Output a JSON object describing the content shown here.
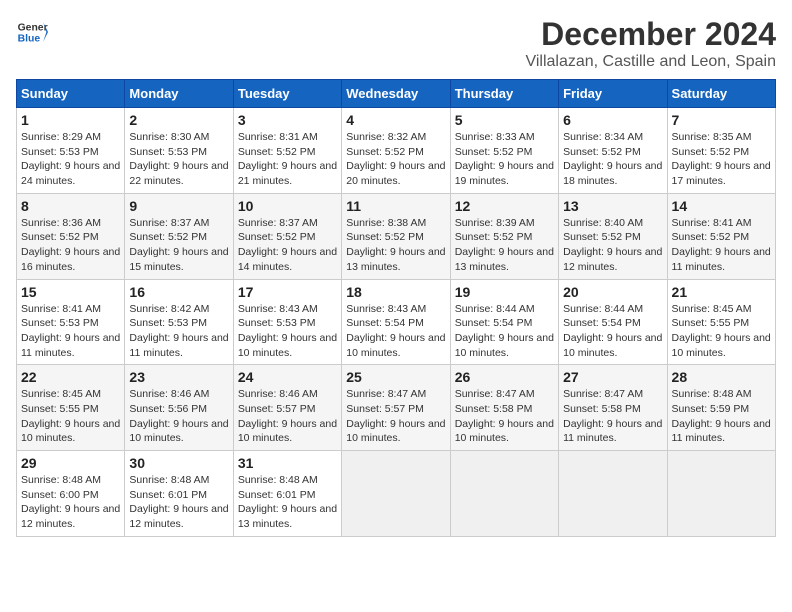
{
  "logo": {
    "line1": "General",
    "line2": "Blue"
  },
  "title": "December 2024",
  "location": "Villalazan, Castille and Leon, Spain",
  "header": {
    "accent_color": "#1565c0"
  },
  "weekdays": [
    "Sunday",
    "Monday",
    "Tuesday",
    "Wednesday",
    "Thursday",
    "Friday",
    "Saturday"
  ],
  "weeks": [
    [
      {
        "day": "1",
        "info": "Sunrise: 8:29 AM\nSunset: 5:53 PM\nDaylight: 9 hours and 24 minutes."
      },
      {
        "day": "2",
        "info": "Sunrise: 8:30 AM\nSunset: 5:53 PM\nDaylight: 9 hours and 22 minutes."
      },
      {
        "day": "3",
        "info": "Sunrise: 8:31 AM\nSunset: 5:52 PM\nDaylight: 9 hours and 21 minutes."
      },
      {
        "day": "4",
        "info": "Sunrise: 8:32 AM\nSunset: 5:52 PM\nDaylight: 9 hours and 20 minutes."
      },
      {
        "day": "5",
        "info": "Sunrise: 8:33 AM\nSunset: 5:52 PM\nDaylight: 9 hours and 19 minutes."
      },
      {
        "day": "6",
        "info": "Sunrise: 8:34 AM\nSunset: 5:52 PM\nDaylight: 9 hours and 18 minutes."
      },
      {
        "day": "7",
        "info": "Sunrise: 8:35 AM\nSunset: 5:52 PM\nDaylight: 9 hours and 17 minutes."
      }
    ],
    [
      {
        "day": "8",
        "info": "Sunrise: 8:36 AM\nSunset: 5:52 PM\nDaylight: 9 hours and 16 minutes."
      },
      {
        "day": "9",
        "info": "Sunrise: 8:37 AM\nSunset: 5:52 PM\nDaylight: 9 hours and 15 minutes."
      },
      {
        "day": "10",
        "info": "Sunrise: 8:37 AM\nSunset: 5:52 PM\nDaylight: 9 hours and 14 minutes."
      },
      {
        "day": "11",
        "info": "Sunrise: 8:38 AM\nSunset: 5:52 PM\nDaylight: 9 hours and 13 minutes."
      },
      {
        "day": "12",
        "info": "Sunrise: 8:39 AM\nSunset: 5:52 PM\nDaylight: 9 hours and 13 minutes."
      },
      {
        "day": "13",
        "info": "Sunrise: 8:40 AM\nSunset: 5:52 PM\nDaylight: 9 hours and 12 minutes."
      },
      {
        "day": "14",
        "info": "Sunrise: 8:41 AM\nSunset: 5:52 PM\nDaylight: 9 hours and 11 minutes."
      }
    ],
    [
      {
        "day": "15",
        "info": "Sunrise: 8:41 AM\nSunset: 5:53 PM\nDaylight: 9 hours and 11 minutes."
      },
      {
        "day": "16",
        "info": "Sunrise: 8:42 AM\nSunset: 5:53 PM\nDaylight: 9 hours and 11 minutes."
      },
      {
        "day": "17",
        "info": "Sunrise: 8:43 AM\nSunset: 5:53 PM\nDaylight: 9 hours and 10 minutes."
      },
      {
        "day": "18",
        "info": "Sunrise: 8:43 AM\nSunset: 5:54 PM\nDaylight: 9 hours and 10 minutes."
      },
      {
        "day": "19",
        "info": "Sunrise: 8:44 AM\nSunset: 5:54 PM\nDaylight: 9 hours and 10 minutes."
      },
      {
        "day": "20",
        "info": "Sunrise: 8:44 AM\nSunset: 5:54 PM\nDaylight: 9 hours and 10 minutes."
      },
      {
        "day": "21",
        "info": "Sunrise: 8:45 AM\nSunset: 5:55 PM\nDaylight: 9 hours and 10 minutes."
      }
    ],
    [
      {
        "day": "22",
        "info": "Sunrise: 8:45 AM\nSunset: 5:55 PM\nDaylight: 9 hours and 10 minutes."
      },
      {
        "day": "23",
        "info": "Sunrise: 8:46 AM\nSunset: 5:56 PM\nDaylight: 9 hours and 10 minutes."
      },
      {
        "day": "24",
        "info": "Sunrise: 8:46 AM\nSunset: 5:57 PM\nDaylight: 9 hours and 10 minutes."
      },
      {
        "day": "25",
        "info": "Sunrise: 8:47 AM\nSunset: 5:57 PM\nDaylight: 9 hours and 10 minutes."
      },
      {
        "day": "26",
        "info": "Sunrise: 8:47 AM\nSunset: 5:58 PM\nDaylight: 9 hours and 10 minutes."
      },
      {
        "day": "27",
        "info": "Sunrise: 8:47 AM\nSunset: 5:58 PM\nDaylight: 9 hours and 11 minutes."
      },
      {
        "day": "28",
        "info": "Sunrise: 8:48 AM\nSunset: 5:59 PM\nDaylight: 9 hours and 11 minutes."
      }
    ],
    [
      {
        "day": "29",
        "info": "Sunrise: 8:48 AM\nSunset: 6:00 PM\nDaylight: 9 hours and 12 minutes."
      },
      {
        "day": "30",
        "info": "Sunrise: 8:48 AM\nSunset: 6:01 PM\nDaylight: 9 hours and 12 minutes."
      },
      {
        "day": "31",
        "info": "Sunrise: 8:48 AM\nSunset: 6:01 PM\nDaylight: 9 hours and 13 minutes."
      },
      null,
      null,
      null,
      null
    ]
  ]
}
